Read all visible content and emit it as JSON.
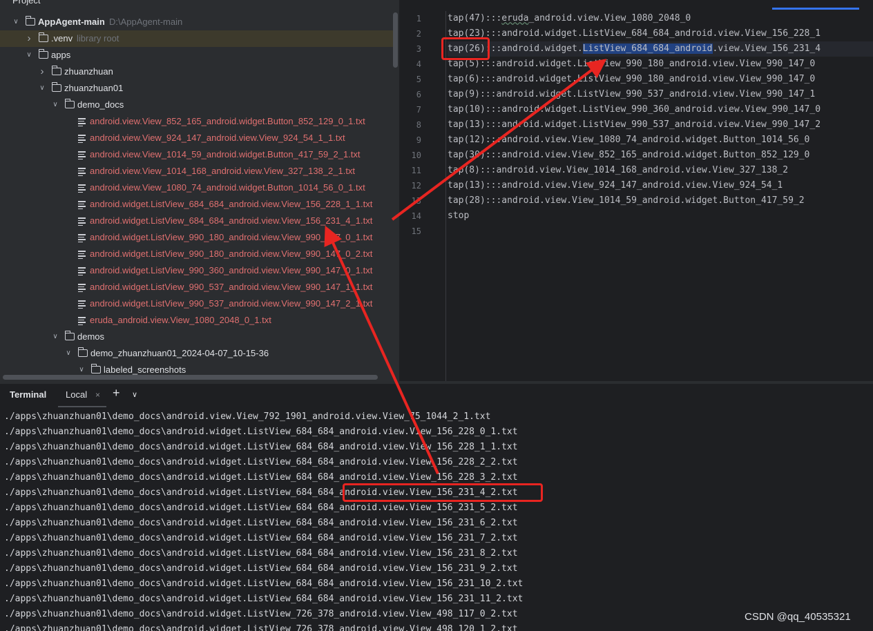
{
  "project_panel": {
    "header": "Project",
    "rows": [
      {
        "kind": "folder",
        "level": 0,
        "expanded": true,
        "label": "AppAgent-main",
        "hint": "D:\\AppAgent-main",
        "bold": true
      },
      {
        "kind": "folder",
        "level": 1,
        "expanded": false,
        "label": ".venv",
        "hint": "library root",
        "selected": true
      },
      {
        "kind": "folder",
        "level": 1,
        "expanded": true,
        "label": "apps"
      },
      {
        "kind": "folder",
        "level": 2,
        "expanded": false,
        "label": "zhuanzhuan"
      },
      {
        "kind": "folder",
        "level": 2,
        "expanded": true,
        "label": "zhuanzhuan01"
      },
      {
        "kind": "folder",
        "level": 3,
        "expanded": true,
        "label": "demo_docs"
      },
      {
        "kind": "file",
        "level": 5,
        "label": "android.view.View_852_165_android.widget.Button_852_129_0_1.txt",
        "red": true
      },
      {
        "kind": "file",
        "level": 5,
        "label": "android.view.View_924_147_android.view.View_924_54_1_1.txt",
        "red": true
      },
      {
        "kind": "file",
        "level": 5,
        "label": "android.view.View_1014_59_android.widget.Button_417_59_2_1.txt",
        "red": true
      },
      {
        "kind": "file",
        "level": 5,
        "label": "android.view.View_1014_168_android.view.View_327_138_2_1.txt",
        "red": true
      },
      {
        "kind": "file",
        "level": 5,
        "label": "android.view.View_1080_74_android.widget.Button_1014_56_0_1.txt",
        "red": true
      },
      {
        "kind": "file",
        "level": 5,
        "label": "android.widget.ListView_684_684_android.view.View_156_228_1_1.txt",
        "red": true
      },
      {
        "kind": "file",
        "level": 5,
        "label": "android.widget.ListView_684_684_android.view.View_156_231_4_1.txt",
        "red": true
      },
      {
        "kind": "file",
        "level": 5,
        "label": "android.widget.ListView_990_180_android.view.View_990_147_0_1.txt",
        "red": true
      },
      {
        "kind": "file",
        "level": 5,
        "label": "android.widget.ListView_990_180_android.view.View_990_147_0_2.txt",
        "red": true
      },
      {
        "kind": "file",
        "level": 5,
        "label": "android.widget.ListView_990_360_android.view.View_990_147_0_1.txt",
        "red": true
      },
      {
        "kind": "file",
        "level": 5,
        "label": "android.widget.ListView_990_537_android.view.View_990_147_1_1.txt",
        "red": true
      },
      {
        "kind": "file",
        "level": 5,
        "label": "android.widget.ListView_990_537_android.view.View_990_147_2_1.txt",
        "red": true
      },
      {
        "kind": "file",
        "level": 5,
        "label": "eruda_android.view.View_1080_2048_0_1.txt",
        "red": true
      },
      {
        "kind": "folder",
        "level": 3,
        "expanded": true,
        "label": "demos"
      },
      {
        "kind": "folder",
        "level": 4,
        "expanded": true,
        "label": "demo_zhuanzhuan01_2024-04-07_10-15-36"
      },
      {
        "kind": "folder",
        "level": 5,
        "expanded": true,
        "label": "labeled_screenshots"
      }
    ]
  },
  "editor": {
    "current_line": 3,
    "lines": [
      {
        "n": "1",
        "pre": "tap(47):::",
        "mark": "eruda",
        "post": "_android.view.View_1080_2048_0"
      },
      {
        "n": "2",
        "pre": "tap(23):::android.widget.ListView_684_684_android.view.View_156_228_1"
      },
      {
        "n": "3",
        "pre": "tap(26):::android.widget.",
        "sel": "ListView_684_684_android",
        "post": ".view.View_156_231_4"
      },
      {
        "n": "4",
        "pre": "tap(5):::android.widget.ListView_990_180_android.view.View_990_147_0"
      },
      {
        "n": "5",
        "pre": "tap(6):::android.widget.ListView_990_180_android.view.View_990_147_0"
      },
      {
        "n": "6",
        "pre": "tap(9):::android.widget.ListView_990_537_android.view.View_990_147_1"
      },
      {
        "n": "7",
        "pre": "tap(10):::android.widget.ListView_990_360_android.view.View_990_147_0"
      },
      {
        "n": "8",
        "pre": "tap(13):::android.widget.ListView_990_537_android.view.View_990_147_2"
      },
      {
        "n": "9",
        "pre": "tap(12):::android.view.View_1080_74_android.widget.Button_1014_56_0"
      },
      {
        "n": "10",
        "pre": "tap(30):::android.view.View_852_165_android.widget.Button_852_129_0"
      },
      {
        "n": "11",
        "pre": "tap(8):::android.view.View_1014_168_android.view.View_327_138_2"
      },
      {
        "n": "12",
        "pre": "tap(13):::android.view.View_924_147_android.view.View_924_54_1"
      },
      {
        "n": "13",
        "pre": "tap(28):::android.view.View_1014_59_android.widget.Button_417_59_2"
      },
      {
        "n": "14",
        "pre": "stop"
      },
      {
        "n": "15",
        "pre": ""
      }
    ]
  },
  "terminal": {
    "title": "Terminal",
    "tab_label": "Local",
    "close_glyph": "×",
    "add_glyph": "+",
    "more_glyph": "∨",
    "lines": [
      "./apps\\zhuanzhuan01\\demo_docs\\android.view.View_792_1901_android.view.View_75_1044_2_1.txt",
      "./apps\\zhuanzhuan01\\demo_docs\\android.widget.ListView_684_684_android.view.View_156_228_0_1.txt",
      "./apps\\zhuanzhuan01\\demo_docs\\android.widget.ListView_684_684_android.view.View_156_228_1_1.txt",
      "./apps\\zhuanzhuan01\\demo_docs\\android.widget.ListView_684_684_android.view.View_156_228_2_2.txt",
      "./apps\\zhuanzhuan01\\demo_docs\\android.widget.ListView_684_684_android.view.View_156_228_3_2.txt",
      "./apps\\zhuanzhuan01\\demo_docs\\android.widget.ListView_684_684_android.view.View_156_231_4_2.txt",
      "./apps\\zhuanzhuan01\\demo_docs\\android.widget.ListView_684_684_android.view.View_156_231_5_2.txt",
      "./apps\\zhuanzhuan01\\demo_docs\\android.widget.ListView_684_684_android.view.View_156_231_6_2.txt",
      "./apps\\zhuanzhuan01\\demo_docs\\android.widget.ListView_684_684_android.view.View_156_231_7_2.txt",
      "./apps\\zhuanzhuan01\\demo_docs\\android.widget.ListView_684_684_android.view.View_156_231_8_2.txt",
      "./apps\\zhuanzhuan01\\demo_docs\\android.widget.ListView_684_684_android.view.View_156_231_9_2.txt",
      "./apps\\zhuanzhuan01\\demo_docs\\android.widget.ListView_684_684_android.view.View_156_231_10_2.txt",
      "./apps\\zhuanzhuan01\\demo_docs\\android.widget.ListView_684_684_android.view.View_156_231_11_2.txt",
      "./apps\\zhuanzhuan01\\demo_docs\\android.widget.ListView_726_378_android.view.View_498_117_0_2.txt",
      "./apps\\zhuanzhuan01\\demo_docs\\android.widget.ListView_726_378_android.view.View_498_120_1_2.txt"
    ]
  },
  "watermark": "CSDN @qq_40535321",
  "colors": {
    "annotation_red": "#e82521",
    "unversioned_file_red": "#e07070",
    "selection_blue": "#214283",
    "accent_blue": "#3574f0"
  }
}
